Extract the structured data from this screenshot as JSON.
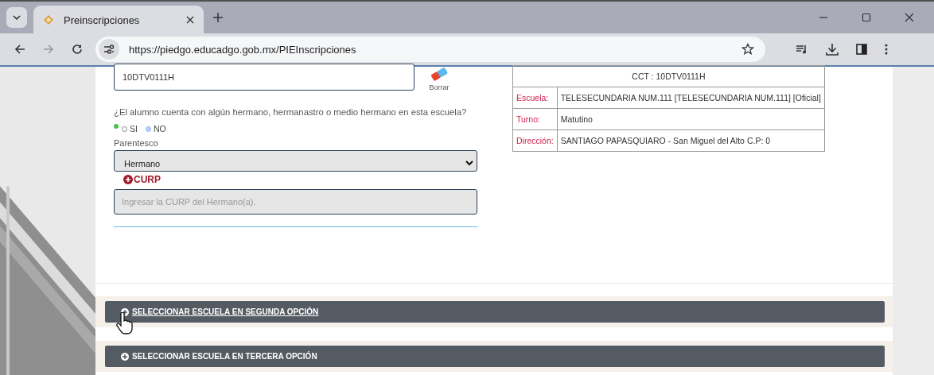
{
  "browser": {
    "tabs": [
      {
        "title": "Preinscripciones",
        "selected": true
      }
    ],
    "url": "https://piedgo.educadgo.gob.mx/PIEInscripciones"
  },
  "form": {
    "cct_value": "10DTV0111H",
    "clear_label": "Borrar",
    "sibling_question": "¿El alumno cuenta con algún hermano, hermanastro o medio hermano en esta escuela?",
    "sibling_options": [
      {
        "label": "SI",
        "selected": false
      },
      {
        "label": "NO",
        "selected": true
      }
    ],
    "relationship_label": "Parentesco",
    "relationship_value": "Hermano",
    "curp_label": "CURP",
    "curp_placeholder": "Ingresar la CURP del Hermano(a)."
  },
  "school_table": {
    "header": "CCT : 10DTV0111H",
    "rows": [
      {
        "label": "Escuela:",
        "value": "TELESECUNDARIA NUM.111 [TELESECUNDARIA NUM.111] [Oficial]"
      },
      {
        "label": "Turno:",
        "value": "Matutino"
      },
      {
        "label": "Dirección:",
        "value": "SANTIAGO PAPASQUIARO - San Miguel del Alto C.P: 0"
      }
    ]
  },
  "accordions": [
    {
      "label": "SELECCIONAR ESCUELA EN SEGUNDA OPCIÓN",
      "hovered": true
    },
    {
      "label": "SELECCIONAR ESCUELA EN TERCERA OPCIÓN",
      "hovered": false
    }
  ]
}
